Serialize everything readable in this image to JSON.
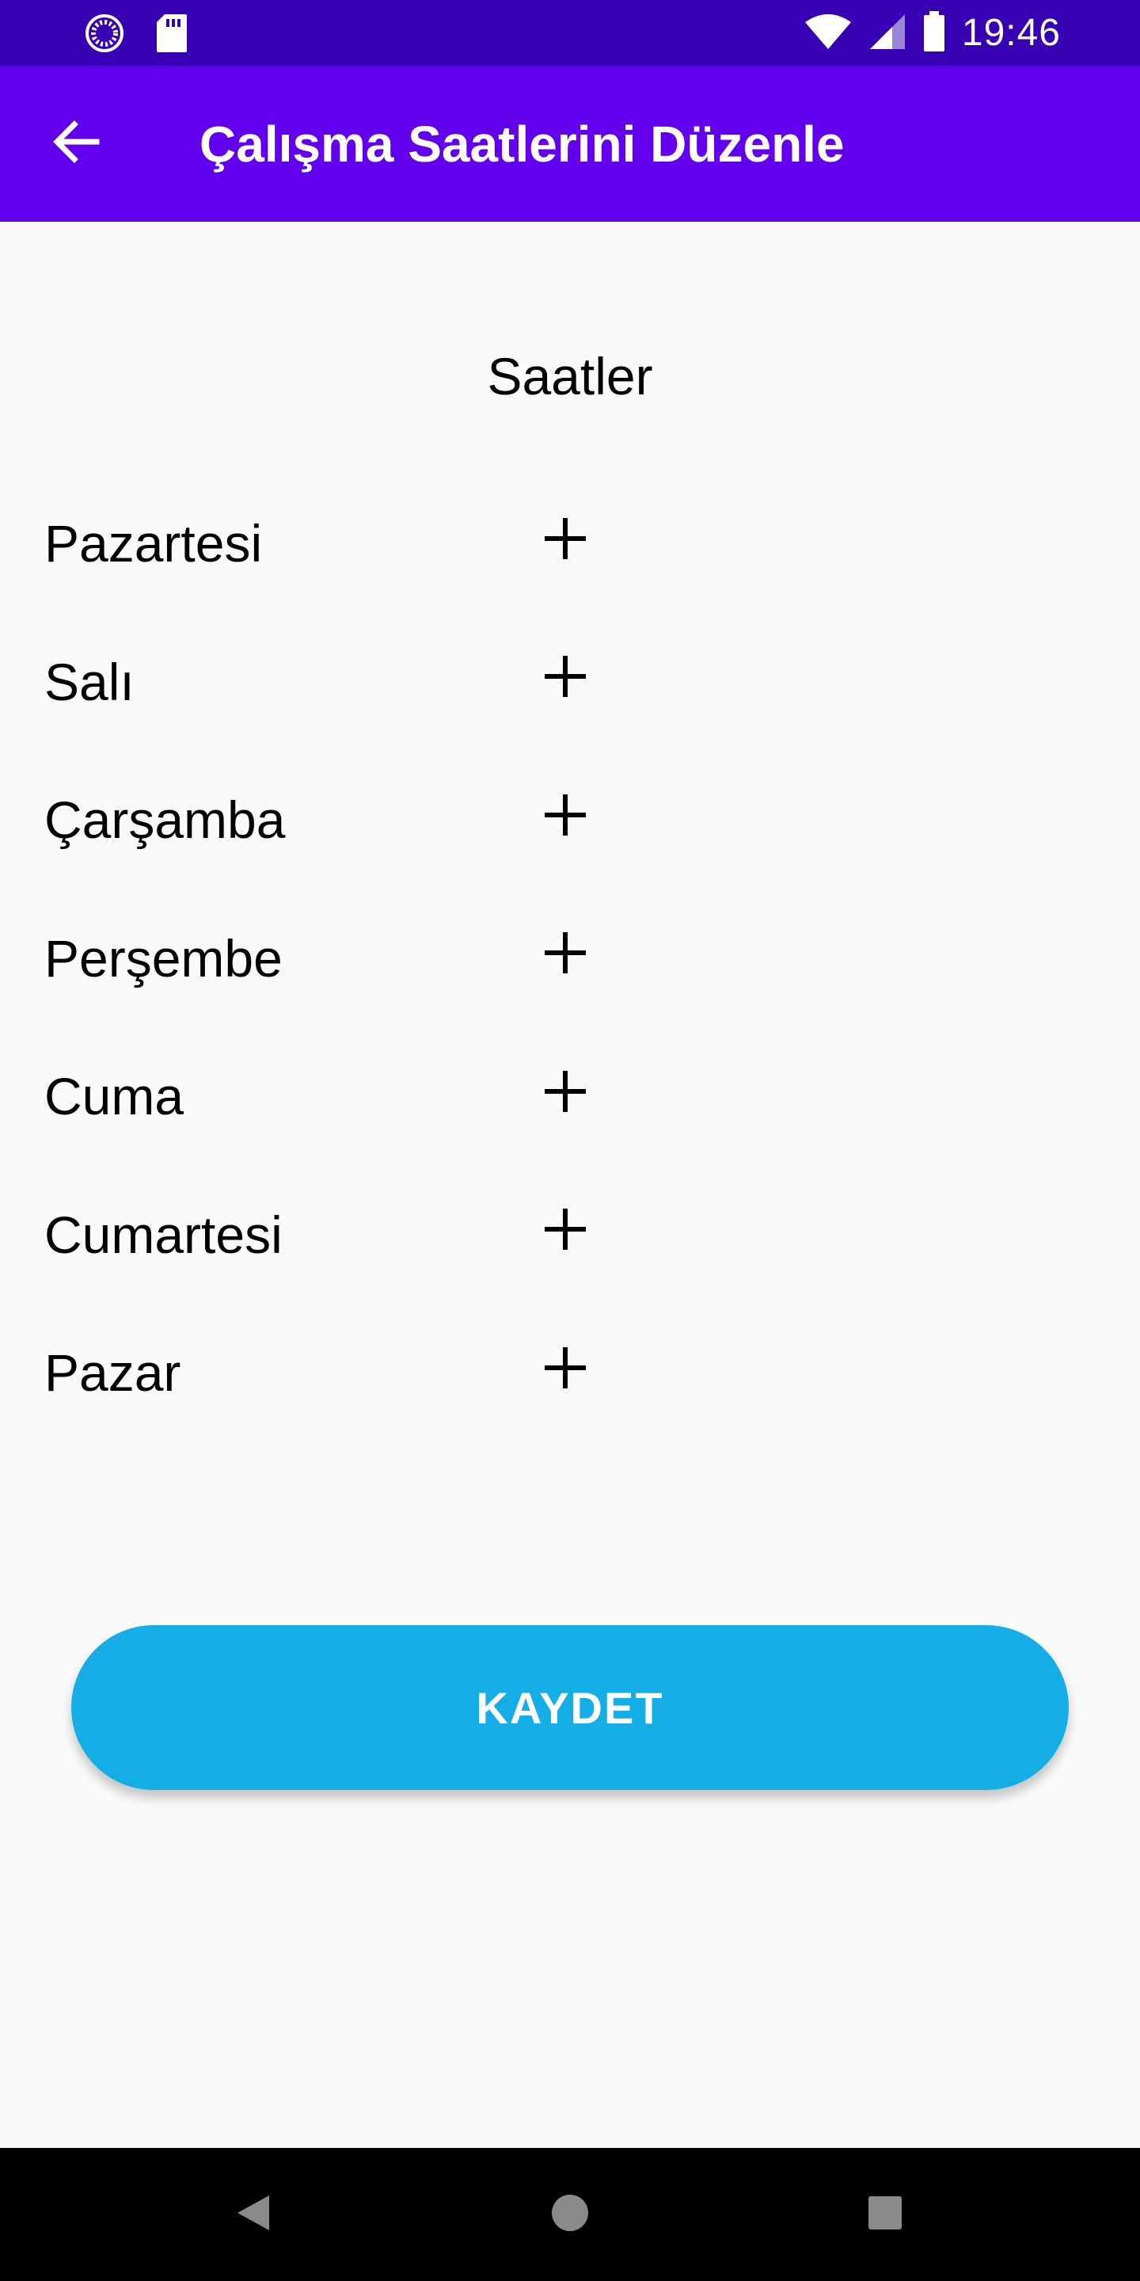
{
  "status_bar": {
    "time": "19:46",
    "icons": [
      "sync-icon",
      "sd-card-icon",
      "wifi-icon",
      "signal-icon",
      "battery-icon"
    ]
  },
  "app_bar": {
    "title": "Çalışma Saatlerini Düzenle",
    "back_icon": "arrow-left-icon"
  },
  "main": {
    "section_title": "Saatler",
    "days": [
      {
        "label": "Pazartesi"
      },
      {
        "label": "Salı"
      },
      {
        "label": "Çarşamba"
      },
      {
        "label": "Perşembe"
      },
      {
        "label": "Cuma"
      },
      {
        "label": "Cumartesi"
      },
      {
        "label": "Pazar"
      }
    ],
    "add_icon": "plus-icon"
  },
  "save_button": {
    "label": "KAYDET"
  },
  "nav_bar": {
    "icons": [
      "back-triangle-icon",
      "home-circle-icon",
      "recents-square-icon"
    ]
  },
  "colors": {
    "status_bar": "#3700b3",
    "app_bar": "#6200ee",
    "save_button": "#15ade6",
    "background": "#fafafa",
    "nav_bar": "#000000"
  }
}
